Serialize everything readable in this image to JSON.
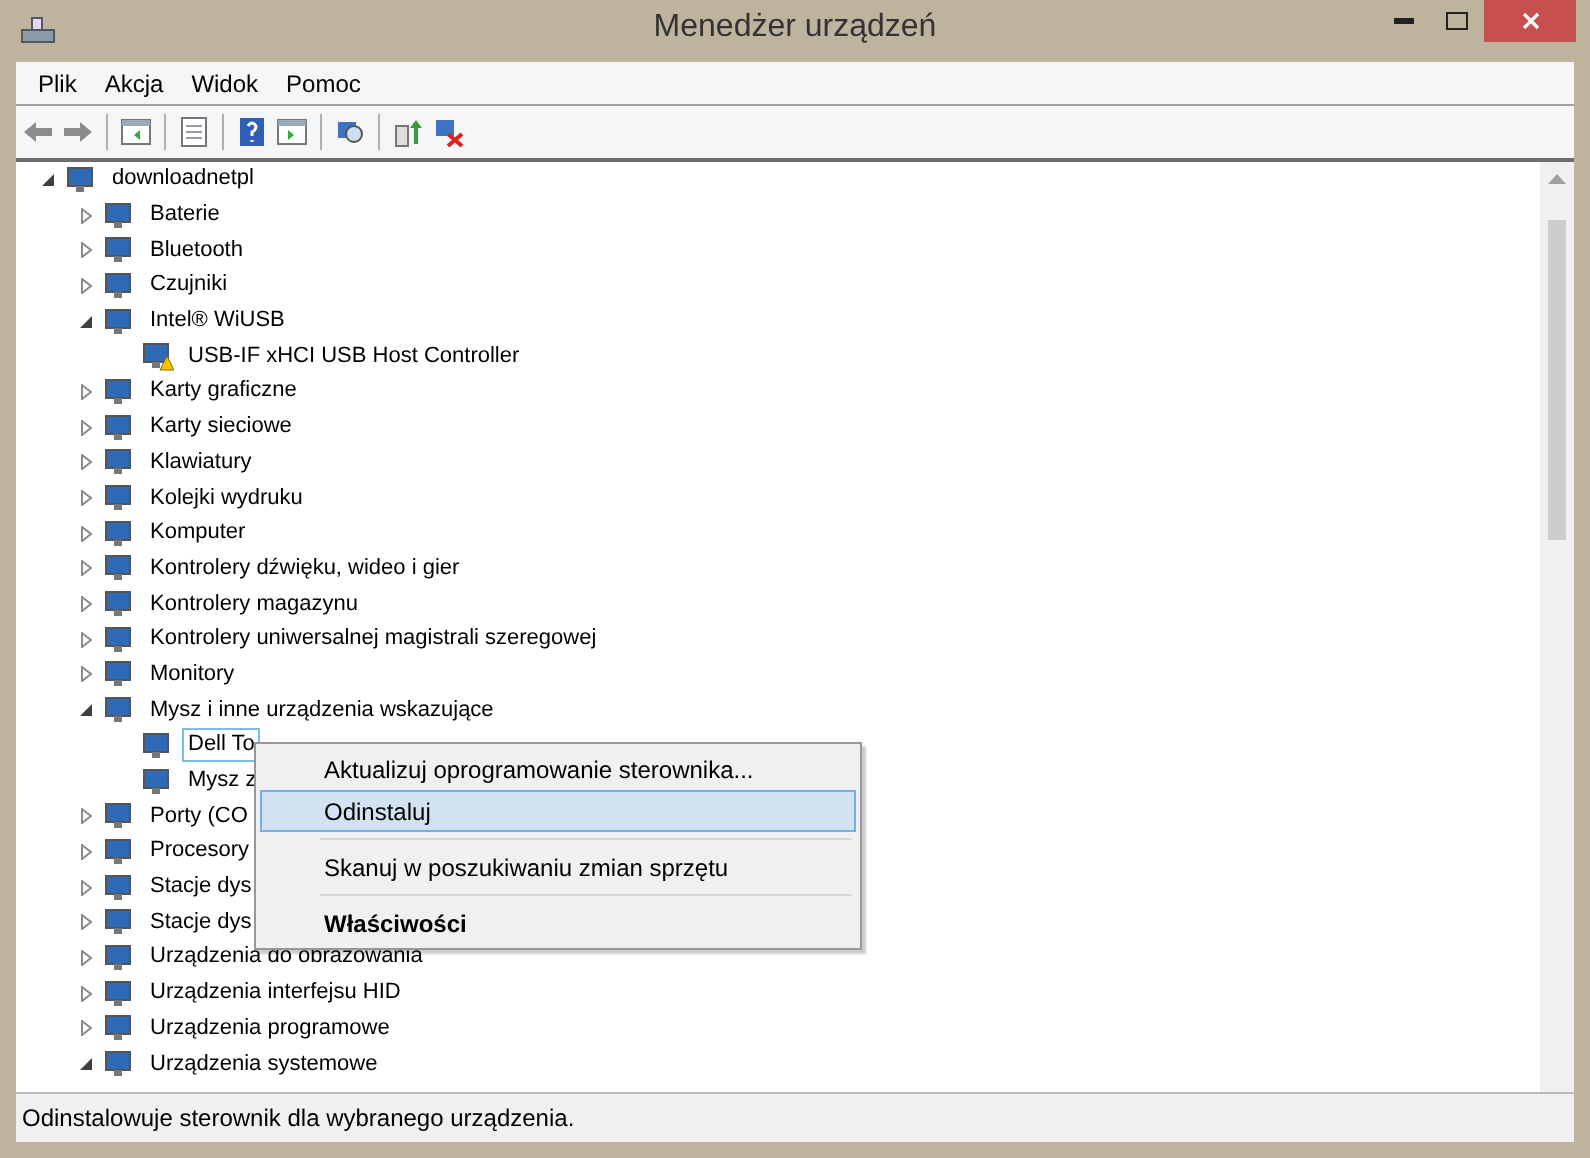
{
  "window": {
    "title": "Menedżer urządzeń"
  },
  "menu_bar": [
    "Plik",
    "Akcja",
    "Widok",
    "Pomoc"
  ],
  "tree": [
    {
      "label": "downloadnetpl",
      "expanded": true,
      "selected": false,
      "children": [
        {
          "label": "Baterie",
          "expanded": false,
          "selected": false
        },
        {
          "label": "Bluetooth",
          "expanded": false,
          "selected": false
        },
        {
          "label": "Czujniki",
          "expanded": false,
          "selected": false
        },
        {
          "label": "Intel® WiUSB",
          "expanded": true,
          "selected": false,
          "children": [
            {
              "label": "USB-IF xHCI USB Host Controller",
              "selected": false,
              "warning": true
            }
          ]
        },
        {
          "label": "Karty graficzne",
          "expanded": false,
          "selected": false
        },
        {
          "label": "Karty sieciowe",
          "expanded": false,
          "selected": false
        },
        {
          "label": "Klawiatury",
          "expanded": false,
          "selected": false
        },
        {
          "label": "Kolejki wydruku",
          "expanded": false,
          "selected": false
        },
        {
          "label": "Komputer",
          "expanded": false,
          "selected": false
        },
        {
          "label": "Kontrolery dźwięku, wideo i gier",
          "expanded": false,
          "selected": false
        },
        {
          "label": "Kontrolery magazynu",
          "expanded": false,
          "selected": false
        },
        {
          "label": "Kontrolery uniwersalnej magistrali szeregowej",
          "expanded": false,
          "selected": false
        },
        {
          "label": "Monitory",
          "expanded": false,
          "selected": false
        },
        {
          "label": "Mysz i inne urządzenia wskazujące",
          "expanded": true,
          "selected": false,
          "children": [
            {
              "label": "Dell To",
              "selected": true
            },
            {
              "label": "Mysz z",
              "selected": false
            }
          ]
        },
        {
          "label": "Porty (CO",
          "expanded": false,
          "selected": false
        },
        {
          "label": "Procesory",
          "expanded": false,
          "selected": false
        },
        {
          "label": "Stacje dys",
          "expanded": false,
          "selected": false
        },
        {
          "label": "Stacje dys",
          "expanded": false,
          "selected": false
        },
        {
          "label": "Urządzenia do obrazowania",
          "expanded": false,
          "selected": false
        },
        {
          "label": "Urządzenia interfejsu HID",
          "expanded": false,
          "selected": false
        },
        {
          "label": "Urządzenia programowe",
          "expanded": false,
          "selected": false
        },
        {
          "label": "Urządzenia systemowe",
          "expanded": true,
          "selected": false
        }
      ]
    }
  ],
  "context_menu": [
    [
      {
        "label": "Aktualizuj oprogramowanie sterownika...",
        "selected": false,
        "default": false
      },
      {
        "label": "Odinstaluj",
        "selected": true,
        "default": false
      }
    ],
    [
      {
        "label": "Skanuj w poszukiwaniu zmian sprzętu",
        "selected": false,
        "default": false
      }
    ],
    [
      {
        "label": "Właściwości",
        "selected": false,
        "default": true
      }
    ]
  ],
  "status_bar": "Odinstalowuje sterownik dla wybranego urządzenia."
}
